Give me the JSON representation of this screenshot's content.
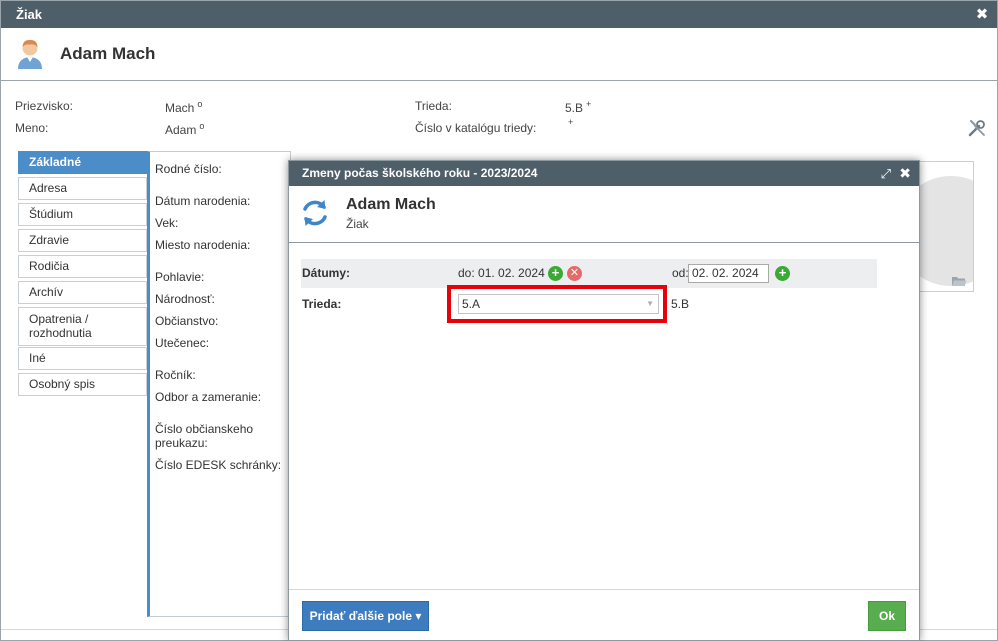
{
  "window": {
    "title": "Žiak",
    "close_glyph": "✖"
  },
  "student": {
    "name": "Adam Mach"
  },
  "info": {
    "surname_label": "Priezvisko:",
    "surname_value": "Mach",
    "surname_mark": "o",
    "firstname_label": "Meno:",
    "firstname_value": "Adam",
    "firstname_mark": "o",
    "class_label": "Trieda:",
    "class_value": "5.B",
    "class_mark": "+",
    "catalog_label": "Číslo v katalógu triedy:",
    "catalog_mark": "+"
  },
  "tabs": [
    {
      "label": "Základné"
    },
    {
      "label": "Adresa"
    },
    {
      "label": "Štúdium"
    },
    {
      "label": "Zdravie"
    },
    {
      "label": "Rodičia"
    },
    {
      "label": "Archív"
    },
    {
      "label": "Opatrenia / rozhodnutia"
    },
    {
      "label": "Iné"
    },
    {
      "label": "Osobný spis"
    }
  ],
  "fields": {
    "birth_number": "Rodné číslo:",
    "birth_date": "Dátum narodenia:",
    "age": "Vek:",
    "birth_place": "Miesto narodenia:",
    "gender": "Pohlavie:",
    "nationality": "Národnosť:",
    "citizenship": "Občianstvo:",
    "refugee": "Utečenec:",
    "year": "Ročník:",
    "field_of_study": "Odbor a zameranie:",
    "id_card": "Číslo občianskeho preukazu:",
    "edesk": "Číslo EDESK schránky:"
  },
  "modal": {
    "title": "Zmeny počas školského roku - 2023/2024",
    "expand_glyph": "⤢",
    "close_glyph": "✖",
    "name": "Adam Mach",
    "role": "Žiak",
    "dates_label": "Dátumy:",
    "from_text": "do: 01. 02. 2024",
    "od_label": "od:",
    "od_value": "02. 02. 2024",
    "class_label": "Trieda:",
    "class_selected": "5.A",
    "class_current": "5.B",
    "add_glyph": "+",
    "remove_glyph": "✕",
    "add_fields_label": "Pridať ďalšie pole ▾",
    "ok_label": "Ok"
  },
  "colors": {
    "titlebar": "#4e5f6a",
    "accent": "#4a8dc8",
    "highlight": "#e8000b",
    "ok": "#58ae4f"
  }
}
